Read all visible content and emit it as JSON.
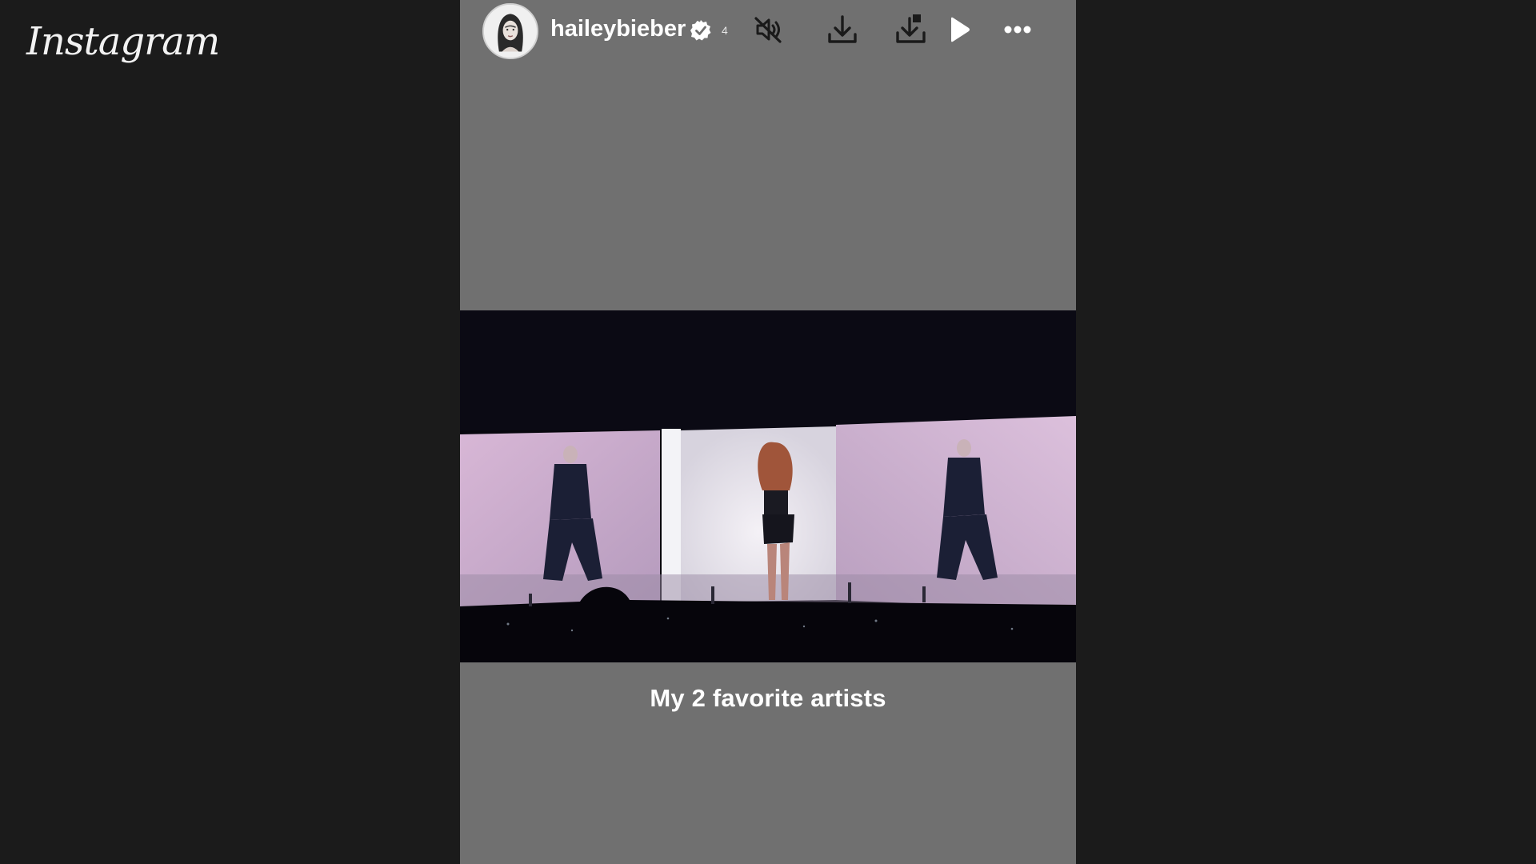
{
  "app": {
    "logo_text": "Instagram"
  },
  "story": {
    "username": "haileybieber",
    "verified": true,
    "time_marker": "4",
    "caption": "My 2 favorite artists",
    "background_color": "#707070"
  },
  "header_icons": [
    {
      "name": "mute-icon",
      "state": "muted"
    },
    {
      "name": "download-icon"
    },
    {
      "name": "download-alt-icon"
    },
    {
      "name": "play-icon"
    },
    {
      "name": "more-options-icon"
    }
  ],
  "media": {
    "description_type": "video",
    "colors": {
      "stage_screen": "#cdb0c9",
      "dark": "#07060d"
    }
  }
}
